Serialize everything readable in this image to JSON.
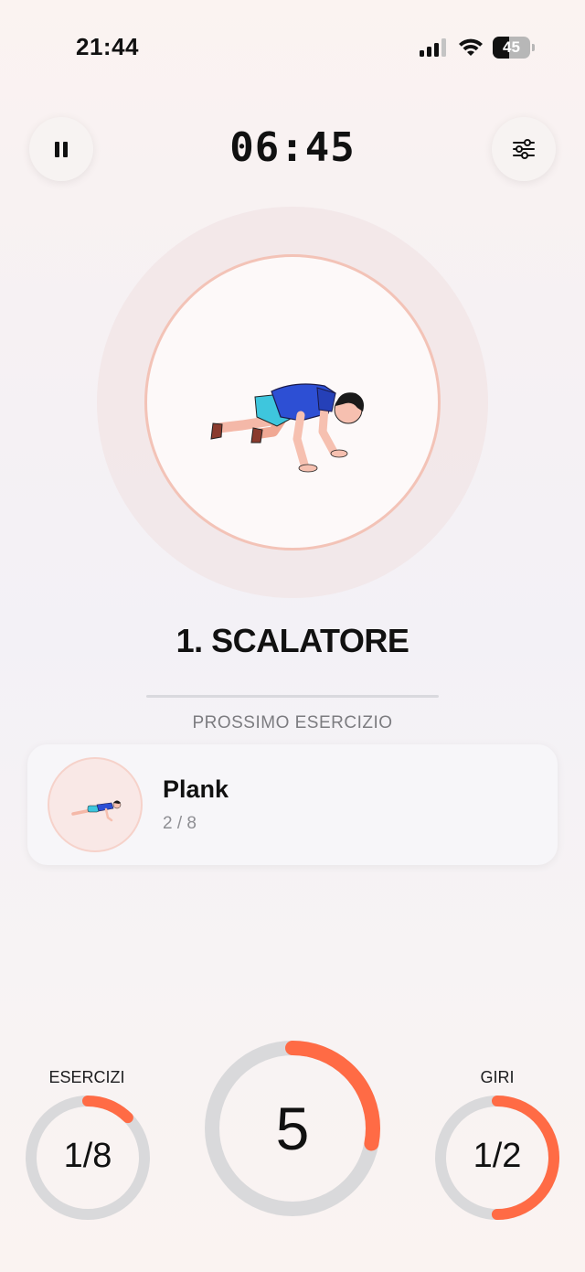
{
  "status_bar": {
    "time": "21:44",
    "battery_level": "45",
    "battery_fraction": 0.45
  },
  "header": {
    "timer": "06:45",
    "pause_icon": "pause-icon",
    "settings_icon": "sliders-icon"
  },
  "current_exercise": {
    "name": "1. SCALATORE"
  },
  "next_exercise": {
    "section_label": "PROSSIMO ESERCIZIO",
    "name": "Plank",
    "position": "2 / 8"
  },
  "progress": {
    "exercises": {
      "label": "ESERCIZI",
      "value": "1/8",
      "fraction": 0.125
    },
    "countdown": {
      "value": "5",
      "fraction": 0.28
    },
    "rounds": {
      "label": "GIRI",
      "value": "1/2",
      "fraction": 0.5
    }
  },
  "colors": {
    "accent": "#ff6b45",
    "ring_track": "#d9d9db"
  }
}
